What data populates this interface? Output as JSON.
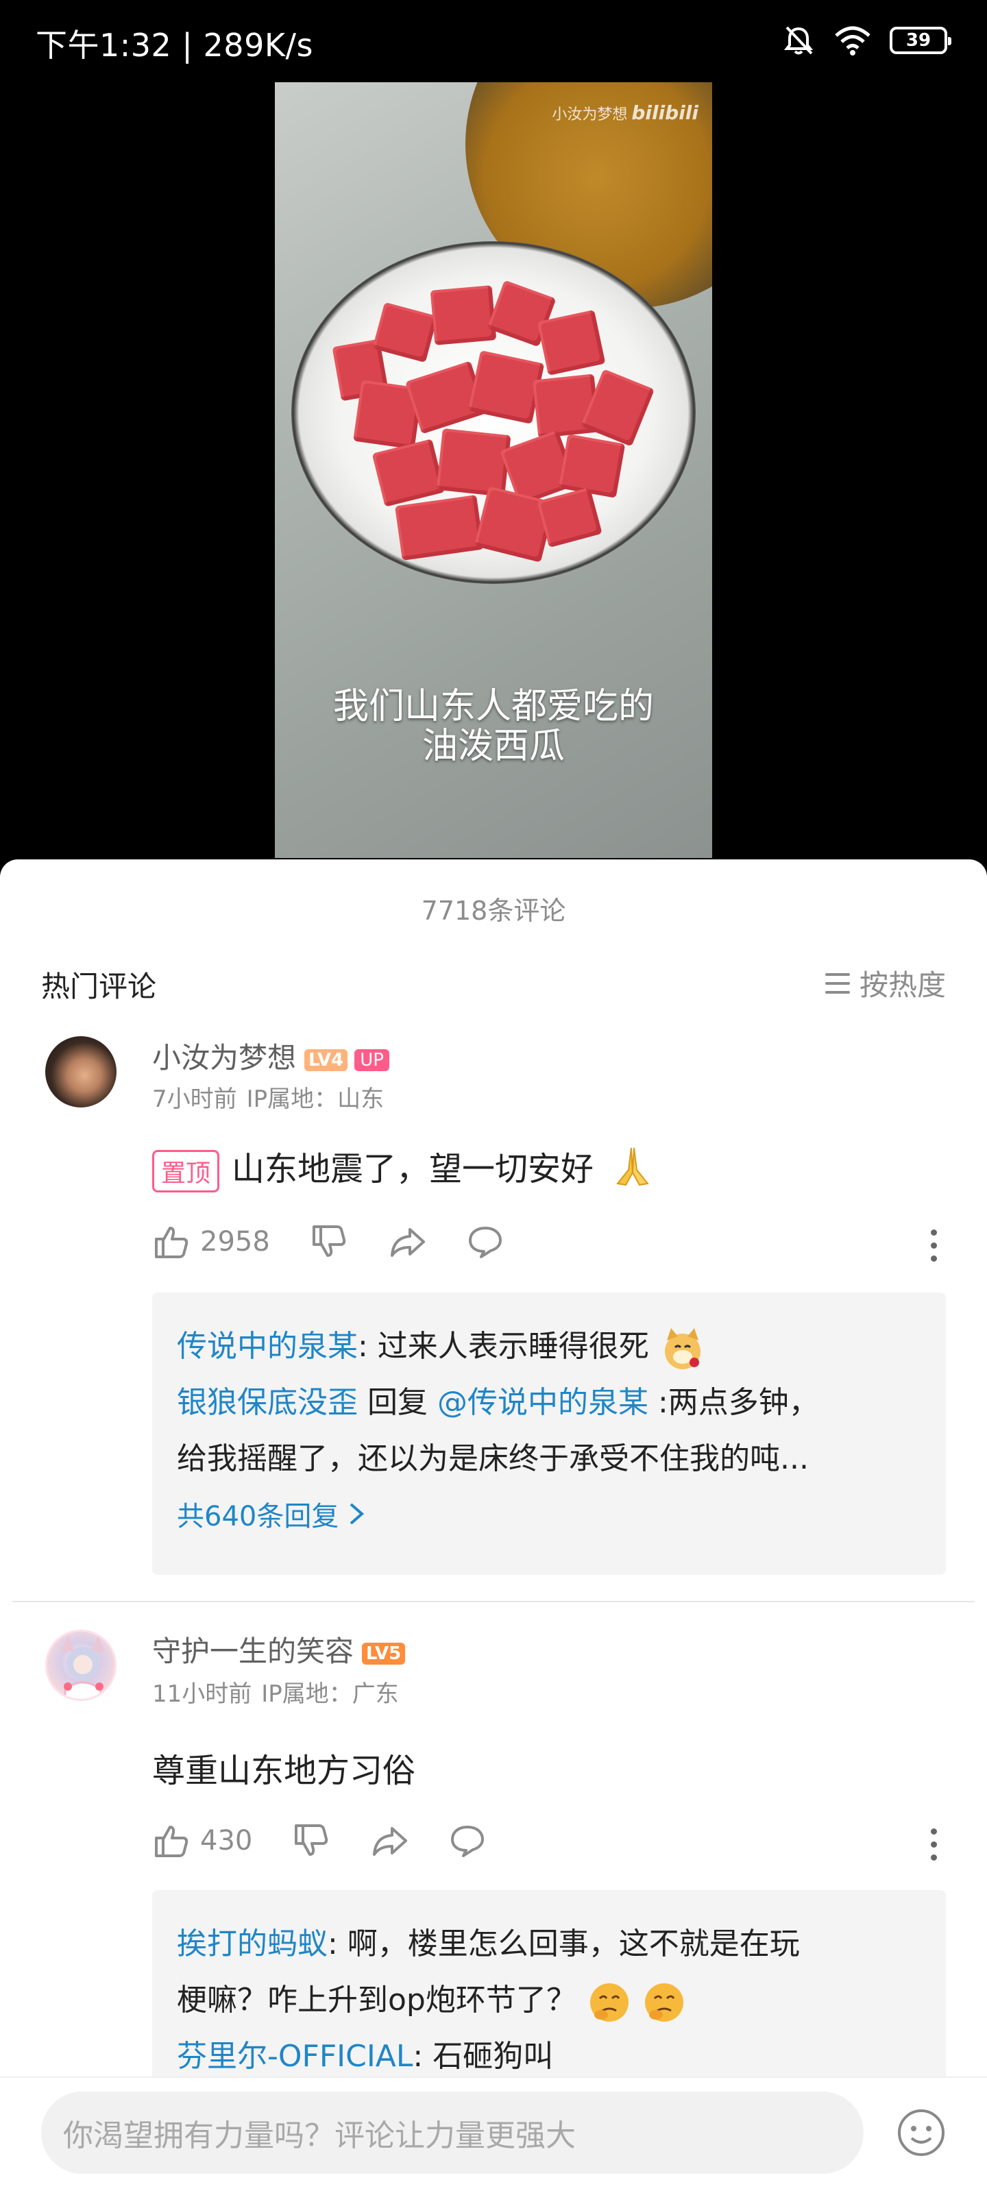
{
  "status_bar": {
    "time_speed": "下午1:32 | 289K/s",
    "battery": "39",
    "icons": [
      "mute-bell-icon",
      "wifi-icon",
      "battery-icon"
    ]
  },
  "video": {
    "watermark_user": "小汝为梦想",
    "watermark_brand": "bilibili",
    "subtitle_line1": "我们山东人都爱吃的",
    "subtitle_line2": "油泼西瓜"
  },
  "comments_header": {
    "count": "7718条评论",
    "section_title": "热门评论",
    "sort_label": "按热度"
  },
  "comments": [
    {
      "username": "小汝为梦想",
      "level": "LV4",
      "up_badge": "UP",
      "time": "7小时前",
      "ip": "IP属地：山东",
      "pin_label": "置顶",
      "text": "山东地震了，望一切安好",
      "likes": "2958",
      "replies": [
        {
          "name": "传说中的泉某",
          "text": ": 过来人表示睡得很死"
        },
        {
          "name": "银狼保底没歪",
          "reply_word": " 回复 ",
          "target": "@传说中的泉某",
          "text": " :两点多钟，"
        },
        {
          "text": "给我摇醒了，还以为是床终于承受不住我的吨..."
        }
      ],
      "more_replies": "共640条回复"
    },
    {
      "username": "守护一生的笑容",
      "level": "LV5",
      "time": "11小时前",
      "ip": "IP属地：广东",
      "text": "尊重山东地方习俗",
      "likes": "430",
      "replies": [
        {
          "name": "挨打的蚂蚁",
          "text": ": 啊，楼里怎么回事，这不就是在玩"
        },
        {
          "text": "梗嘛？咋上升到op炮环节了？"
        },
        {
          "name": "芬里尔-OFFICIAL",
          "text": ": 石砸狗叫"
        }
      ]
    }
  ],
  "input": {
    "placeholder": "你渴望拥有力量吗？评论让力量更强大"
  }
}
